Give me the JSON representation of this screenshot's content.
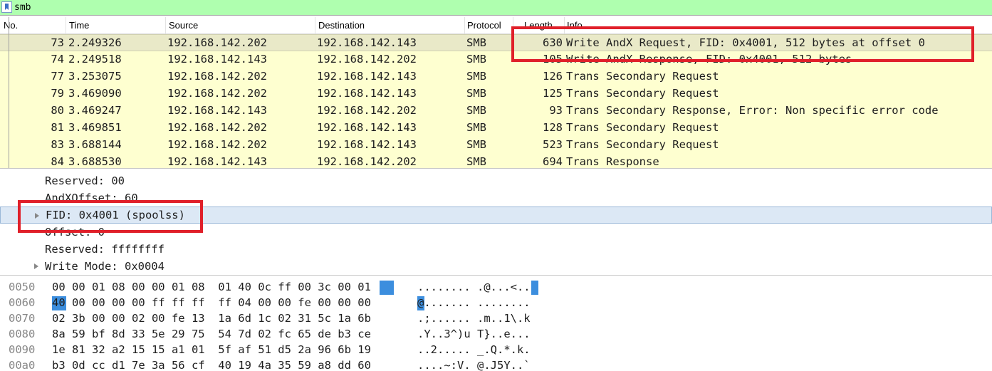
{
  "filter": {
    "value": "smb",
    "icon": "bookmark-icon"
  },
  "columns": {
    "no": "No.",
    "time": "Time",
    "source": "Source",
    "destination": "Destination",
    "protocol": "Protocol",
    "length": "Length",
    "info": "Info"
  },
  "packets": [
    {
      "no": "73",
      "time": "2.249326",
      "source": "192.168.142.202",
      "destination": "192.168.142.143",
      "protocol": "SMB",
      "length": "630",
      "info": "Write AndX Request, FID: 0x4001, 512 bytes at offset 0"
    },
    {
      "no": "74",
      "time": "2.249518",
      "source": "192.168.142.143",
      "destination": "192.168.142.202",
      "protocol": "SMB",
      "length": "105",
      "info": "Write AndX Response, FID: 0x4001, 512 bytes"
    },
    {
      "no": "77",
      "time": "3.253075",
      "source": "192.168.142.202",
      "destination": "192.168.142.143",
      "protocol": "SMB",
      "length": "126",
      "info": "Trans Secondary Request"
    },
    {
      "no": "79",
      "time": "3.469090",
      "source": "192.168.142.202",
      "destination": "192.168.142.143",
      "protocol": "SMB",
      "length": "125",
      "info": "Trans Secondary Request"
    },
    {
      "no": "80",
      "time": "3.469247",
      "source": "192.168.142.143",
      "destination": "192.168.142.202",
      "protocol": "SMB",
      "length": "93",
      "info": "Trans Secondary Response, Error: Non specific error code"
    },
    {
      "no": "81",
      "time": "3.469851",
      "source": "192.168.142.202",
      "destination": "192.168.142.143",
      "protocol": "SMB",
      "length": "128",
      "info": "Trans Secondary Request"
    },
    {
      "no": "83",
      "time": "3.688144",
      "source": "192.168.142.202",
      "destination": "192.168.142.143",
      "protocol": "SMB",
      "length": "523",
      "info": "Trans Secondary Request"
    },
    {
      "no": "84",
      "time": "3.688530",
      "source": "192.168.142.143",
      "destination": "192.168.142.202",
      "protocol": "SMB",
      "length": "694",
      "info": "Trans Response"
    }
  ],
  "details": [
    {
      "text": "Reserved: 00"
    },
    {
      "text": "AndXOffset: 60"
    },
    {
      "text": "FID: 0x4001 (spoolss)"
    },
    {
      "text": "Offset: 0"
    },
    {
      "text": "Reserved: ffffffff"
    },
    {
      "text": "Write Mode: 0x0004"
    }
  ],
  "bytes": [
    {
      "offset": "0050",
      "hex": "00 00 01 08 00 00 01 08  01 40 0c ff 00 3c 00 01",
      "ascii": "........ .@...<.."
    },
    {
      "offset": "0060",
      "hex": "40 00 00 00 00 ff ff ff  ff 04 00 00 fe 00 00 00",
      "ascii": "@....... ........"
    },
    {
      "offset": "0070",
      "hex": "02 3b 00 00 02 00 fe 13  1a 6d 1c 02 31 5c 1a 6b",
      "ascii": ".;...... .m..1\\.k"
    },
    {
      "offset": "0080",
      "hex": "8a 59 bf 8d 33 5e 29 75  54 7d 02 fc 65 de b3 ce",
      "ascii": ".Y..3^)u T}..e..."
    },
    {
      "offset": "0090",
      "hex": "1e 81 32 a2 15 15 a1 01  5f af 51 d5 2a 96 6b 19",
      "ascii": "..2..... _.Q.*.k."
    },
    {
      "offset": "00a0",
      "hex": "b3 0d cc d1 7e 3a 56 cf  40 19 4a 35 59 a8 dd 60",
      "ascii": "....~:V. @.J5Y..`"
    }
  ],
  "colors": {
    "filter_bg": "#afffaf",
    "row_bg": "#feffd0",
    "selection": "#3c8ede",
    "annotation": "#e0202a"
  }
}
